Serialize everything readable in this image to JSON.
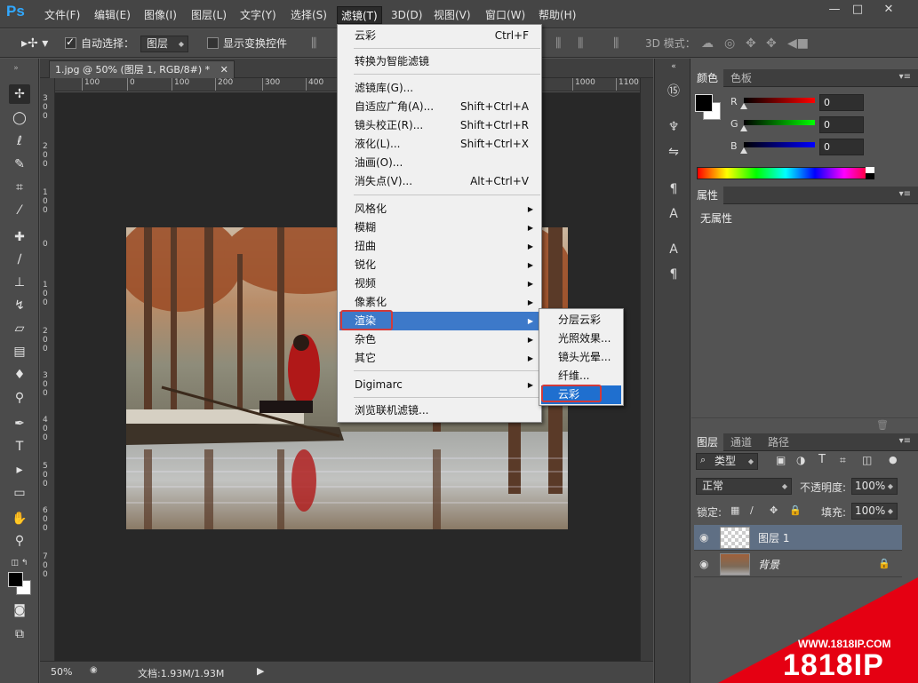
{
  "app": {
    "logo": "Ps",
    "window_controls": [
      "—",
      "□",
      "✕"
    ]
  },
  "menubar": {
    "items": [
      "文件(F)",
      "编辑(E)",
      "图像(I)",
      "图层(L)",
      "文字(Y)",
      "选择(S)",
      "滤镜(T)",
      "3D(D)",
      "视图(V)",
      "窗口(W)",
      "帮助(H)"
    ],
    "active": "滤镜(T)"
  },
  "options": {
    "auto_select_label": "自动选择：",
    "auto_select_checked": true,
    "auto_select_target": "图层",
    "show_transform_label": "显示变换控件",
    "show_transform_checked": false,
    "mode_3d_label": "3D 模式："
  },
  "document": {
    "tab_title": "1.jpg @ 50% (图层 1, RGB/8#) *",
    "zoom": "50%",
    "doc_size": "文档:1.93M/1.93M",
    "ruler_top": [
      "100",
      "0",
      "100",
      "200",
      "300",
      "400",
      "1000",
      "1100"
    ],
    "ruler_left": [
      "3 0 0",
      "2 0 0",
      "1 0 0",
      "0",
      "1 0 0",
      "2 0 0",
      "3 0 0",
      "4 0 0",
      "5 0 0",
      "6 0 0",
      "7 0 0"
    ]
  },
  "filter_menu": {
    "items": [
      {
        "label": "云彩",
        "shortcut": "Ctrl+F"
      },
      {
        "label": "转换为智能滤镜"
      },
      {
        "label": "滤镜库(G)..."
      },
      {
        "label": "自适应广角(A)...",
        "shortcut": "Shift+Ctrl+A"
      },
      {
        "label": "镜头校正(R)...",
        "shortcut": "Shift+Ctrl+R"
      },
      {
        "label": "液化(L)...",
        "shortcut": "Shift+Ctrl+X"
      },
      {
        "label": "油画(O)..."
      },
      {
        "label": "消失点(V)...",
        "shortcut": "Alt+Ctrl+V"
      },
      {
        "label": "风格化",
        "submenu": true
      },
      {
        "label": "模糊",
        "submenu": true
      },
      {
        "label": "扭曲",
        "submenu": true
      },
      {
        "label": "锐化",
        "submenu": true
      },
      {
        "label": "视频",
        "submenu": true
      },
      {
        "label": "像素化",
        "submenu": true
      },
      {
        "label": "渲染",
        "submenu": true,
        "highlighted": true
      },
      {
        "label": "杂色",
        "submenu": true
      },
      {
        "label": "其它",
        "submenu": true
      },
      {
        "label": "Digimarc",
        "submenu": true
      },
      {
        "label": "浏览联机滤镜..."
      }
    ]
  },
  "render_submenu": {
    "items": [
      "分层云彩",
      "光照效果...",
      "镜头光晕...",
      "纤维...",
      "云彩"
    ],
    "selected": "云彩"
  },
  "color_panel": {
    "tabs": [
      "颜色",
      "色板"
    ],
    "channels": [
      {
        "name": "R",
        "value": "0"
      },
      {
        "name": "G",
        "value": "0"
      },
      {
        "name": "B",
        "value": "0"
      }
    ]
  },
  "properties_panel": {
    "tab": "属性",
    "empty_text": "无属性"
  },
  "layers_panel": {
    "tabs": [
      "图层",
      "通道",
      "路径"
    ],
    "filter_kind": "类型",
    "blend_mode": "正常",
    "opacity_label": "不透明度:",
    "opacity_value": "100%",
    "lock_label": "锁定:",
    "fill_label": "填充:",
    "fill_value": "100%",
    "layers": [
      {
        "name": "图层 1",
        "selected": true,
        "transparent": true
      },
      {
        "name": "背景",
        "selected": false,
        "locked": true
      }
    ]
  },
  "watermark": {
    "url": "WWW.1818IP.COM",
    "brand": "1818IP"
  },
  "colors": {
    "accent_blue": "#3d79c9",
    "highlight_red": "#d23a3a",
    "watermark_red": "#e50012"
  }
}
